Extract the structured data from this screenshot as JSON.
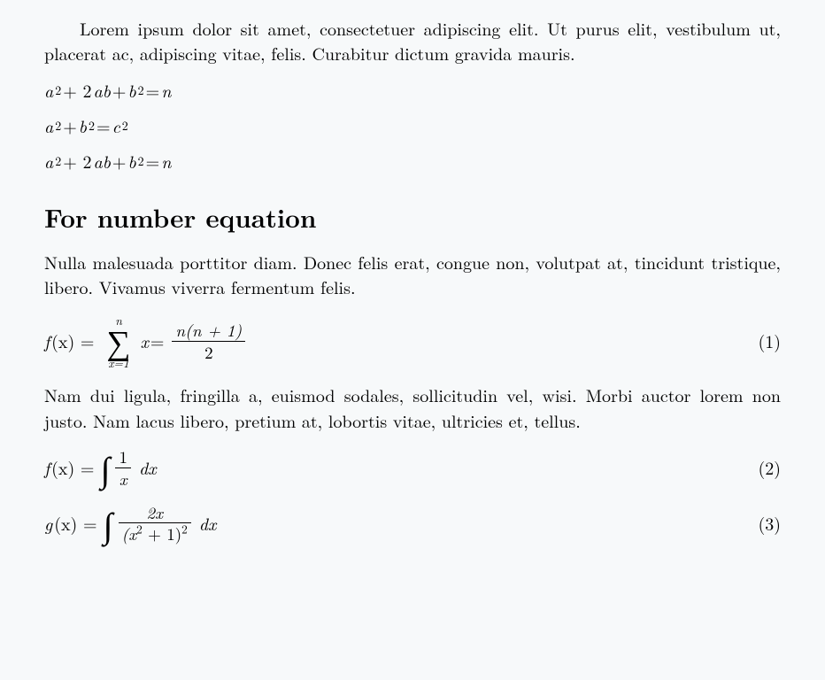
{
  "para1": "Lorem ipsum dolor sit amet, consectetuer adipiscing elit. Ut purus elit, vestibulum ut, placerat ac, adipiscing vitae, felis. Curabitur dictum gravida mauris.",
  "eq1_a": "a",
  "eq1_p2a": "2",
  "eq1_plus1": " + 2",
  "eq1_ab": "ab",
  "eq1_plus2": " + ",
  "eq1_b": "b",
  "eq1_p2b": "2",
  "eq1_eq": " = ",
  "eq1_n": "n",
  "eq2_a": "a",
  "eq2_p2a": "2",
  "eq2_plus": " + ",
  "eq2_b": "b",
  "eq2_p2b": "2",
  "eq2_eq": " = ",
  "eq2_c": "c",
  "eq2_p2c": "2",
  "eq3_a": "a",
  "eq3_p2a": "2",
  "eq3_plus1": " + 2",
  "eq3_ab": "ab",
  "eq3_plus2": " + ",
  "eq3_b": "b",
  "eq3_p2b": "2",
  "eq3_eq": " = ",
  "eq3_n": "n",
  "heading": "For number equation",
  "para2": "Nulla malesuada porttitor diam. Donec felis erat, congue non, volutpat at, tincidunt tristique, libero. Vivamus viverra fermentum felis.",
  "eqA_lhs_f": "f",
  "eqA_lhs_x": "(x) = ",
  "eqA_sum_top": "n",
  "eqA_sum_sym": "∑",
  "eqA_sum_bot": "x=1",
  "eqA_mid_x": "x",
  "eqA_mid_eq": " = ",
  "eqA_frac_num": "n(n + 1)",
  "eqA_frac_den": "2",
  "eqA_num": "(1)",
  "para3": "Nam dui ligula, fringilla a, euismod sodales, sollicitudin vel, wisi. Morbi auctor lorem non justo. Nam lacus libero, pretium at, lobortis vitae, ultricies et, tellus.",
  "eqB_lhs_f": "f",
  "eqB_lhs_x": "(x) = ",
  "eqB_int": "∫",
  "eqB_frac_num": "1",
  "eqB_frac_den": "x",
  "eqB_dx": " dx",
  "eqB_num": "(2)",
  "eqC_lhs_g": "g",
  "eqC_lhs_x": "(x) = ",
  "eqC_int": "∫",
  "eqC_frac_num": "2x",
  "eqC_frac_den_pre": "(x",
  "eqC_frac_den_sup": "2",
  "eqC_frac_den_mid": " + 1)",
  "eqC_frac_den_sup2": "2",
  "eqC_dx": " dx",
  "eqC_num": "(3)"
}
